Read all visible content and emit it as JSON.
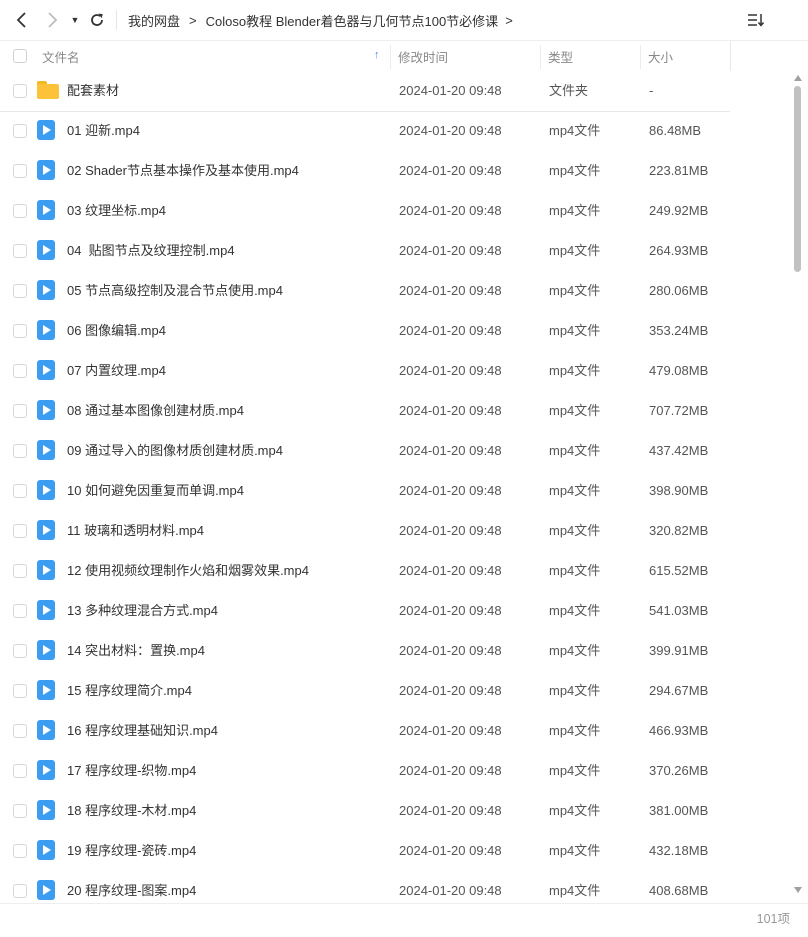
{
  "toolbar": {
    "back_icon": "chevron-left-icon",
    "forward_icon": "chevron-right-icon",
    "dropdown_icon": "caret-down-icon",
    "refresh_icon": "refresh-icon",
    "sort_view_icon": "sort-list-icon",
    "dropdown_glyph": "▼"
  },
  "breadcrumb": {
    "items": [
      "我的网盘",
      "Coloso教程 Blender着色器与几何节点100节必修课"
    ],
    "separator": ">"
  },
  "header": {
    "name": "文件名",
    "sort_arrow": "↑",
    "time": "修改时间",
    "type": "类型",
    "size": "大小"
  },
  "files": [
    {
      "name": "配套素材",
      "time": "2024-01-20 09:48",
      "type": "文件夹",
      "size": "-",
      "icon": "folder-icon"
    },
    {
      "name": "01 迎新.mp4",
      "time": "2024-01-20 09:48",
      "type": "mp4文件",
      "size": "86.48MB",
      "icon": "video-file-icon"
    },
    {
      "name": "02 Shader节点基本操作及基本使用.mp4",
      "time": "2024-01-20 09:48",
      "type": "mp4文件",
      "size": "223.81MB",
      "icon": "video-file-icon"
    },
    {
      "name": "03 纹理坐标.mp4",
      "time": "2024-01-20 09:48",
      "type": "mp4文件",
      "size": "249.92MB",
      "icon": "video-file-icon"
    },
    {
      "name": "04  贴图节点及纹理控制.mp4",
      "time": "2024-01-20 09:48",
      "type": "mp4文件",
      "size": "264.93MB",
      "icon": "video-file-icon"
    },
    {
      "name": "05 节点高级控制及混合节点使用.mp4",
      "time": "2024-01-20 09:48",
      "type": "mp4文件",
      "size": "280.06MB",
      "icon": "video-file-icon"
    },
    {
      "name": "06 图像编辑.mp4",
      "time": "2024-01-20 09:48",
      "type": "mp4文件",
      "size": "353.24MB",
      "icon": "video-file-icon"
    },
    {
      "name": "07 内置纹理.mp4",
      "time": "2024-01-20 09:48",
      "type": "mp4文件",
      "size": "479.08MB",
      "icon": "video-file-icon"
    },
    {
      "name": "08 通过基本图像创建材质.mp4",
      "time": "2024-01-20 09:48",
      "type": "mp4文件",
      "size": "707.72MB",
      "icon": "video-file-icon"
    },
    {
      "name": "09 通过导入的图像材质创建材质.mp4",
      "time": "2024-01-20 09:48",
      "type": "mp4文件",
      "size": "437.42MB",
      "icon": "video-file-icon"
    },
    {
      "name": "10 如何避免因重复而单调.mp4",
      "time": "2024-01-20 09:48",
      "type": "mp4文件",
      "size": "398.90MB",
      "icon": "video-file-icon"
    },
    {
      "name": "11 玻璃和透明材料.mp4",
      "time": "2024-01-20 09:48",
      "type": "mp4文件",
      "size": "320.82MB",
      "icon": "video-file-icon"
    },
    {
      "name": "12 使用视频纹理制作火焰和烟雾效果.mp4",
      "time": "2024-01-20 09:48",
      "type": "mp4文件",
      "size": "615.52MB",
      "icon": "video-file-icon"
    },
    {
      "name": "13 多种纹理混合方式.mp4",
      "time": "2024-01-20 09:48",
      "type": "mp4文件",
      "size": "541.03MB",
      "icon": "video-file-icon"
    },
    {
      "name": "14 突出材料：置换.mp4",
      "time": "2024-01-20 09:48",
      "type": "mp4文件",
      "size": "399.91MB",
      "icon": "video-file-icon"
    },
    {
      "name": "15 程序纹理简介.mp4",
      "time": "2024-01-20 09:48",
      "type": "mp4文件",
      "size": "294.67MB",
      "icon": "video-file-icon"
    },
    {
      "name": "16 程序纹理基础知识.mp4",
      "time": "2024-01-20 09:48",
      "type": "mp4文件",
      "size": "466.93MB",
      "icon": "video-file-icon"
    },
    {
      "name": "17 程序纹理-织物.mp4",
      "time": "2024-01-20 09:48",
      "type": "mp4文件",
      "size": "370.26MB",
      "icon": "video-file-icon"
    },
    {
      "name": "18 程序纹理-木材.mp4",
      "time": "2024-01-20 09:48",
      "type": "mp4文件",
      "size": "381.00MB",
      "icon": "video-file-icon"
    },
    {
      "name": "19 程序纹理-瓷砖.mp4",
      "time": "2024-01-20 09:48",
      "type": "mp4文件",
      "size": "432.18MB",
      "icon": "video-file-icon"
    },
    {
      "name": "20 程序纹理-图案.mp4",
      "time": "2024-01-20 09:48",
      "type": "mp4文件",
      "size": "408.68MB",
      "icon": "video-file-icon"
    }
  ],
  "footer": {
    "count": "101项"
  },
  "colors": {
    "accent": "#3a8ef6",
    "video_icon": "#3c9cf2",
    "folder_icon": "#fcc33a"
  }
}
